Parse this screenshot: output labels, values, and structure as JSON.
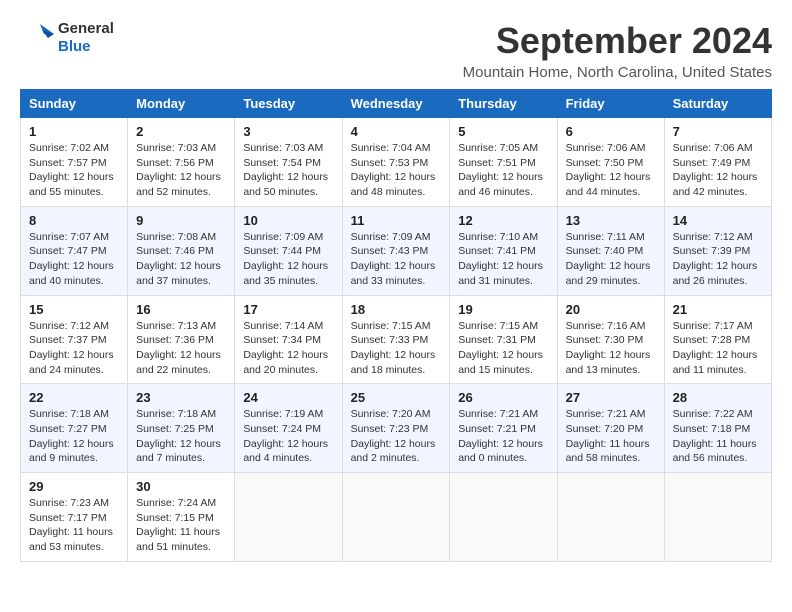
{
  "logo": {
    "text_general": "General",
    "text_blue": "Blue"
  },
  "title": "September 2024",
  "location": "Mountain Home, North Carolina, United States",
  "days_of_week": [
    "Sunday",
    "Monday",
    "Tuesday",
    "Wednesday",
    "Thursday",
    "Friday",
    "Saturday"
  ],
  "weeks": [
    [
      {
        "day": "1",
        "info": "Sunrise: 7:02 AM\nSunset: 7:57 PM\nDaylight: 12 hours\nand 55 minutes."
      },
      {
        "day": "2",
        "info": "Sunrise: 7:03 AM\nSunset: 7:56 PM\nDaylight: 12 hours\nand 52 minutes."
      },
      {
        "day": "3",
        "info": "Sunrise: 7:03 AM\nSunset: 7:54 PM\nDaylight: 12 hours\nand 50 minutes."
      },
      {
        "day": "4",
        "info": "Sunrise: 7:04 AM\nSunset: 7:53 PM\nDaylight: 12 hours\nand 48 minutes."
      },
      {
        "day": "5",
        "info": "Sunrise: 7:05 AM\nSunset: 7:51 PM\nDaylight: 12 hours\nand 46 minutes."
      },
      {
        "day": "6",
        "info": "Sunrise: 7:06 AM\nSunset: 7:50 PM\nDaylight: 12 hours\nand 44 minutes."
      },
      {
        "day": "7",
        "info": "Sunrise: 7:06 AM\nSunset: 7:49 PM\nDaylight: 12 hours\nand 42 minutes."
      }
    ],
    [
      {
        "day": "8",
        "info": "Sunrise: 7:07 AM\nSunset: 7:47 PM\nDaylight: 12 hours\nand 40 minutes."
      },
      {
        "day": "9",
        "info": "Sunrise: 7:08 AM\nSunset: 7:46 PM\nDaylight: 12 hours\nand 37 minutes."
      },
      {
        "day": "10",
        "info": "Sunrise: 7:09 AM\nSunset: 7:44 PM\nDaylight: 12 hours\nand 35 minutes."
      },
      {
        "day": "11",
        "info": "Sunrise: 7:09 AM\nSunset: 7:43 PM\nDaylight: 12 hours\nand 33 minutes."
      },
      {
        "day": "12",
        "info": "Sunrise: 7:10 AM\nSunset: 7:41 PM\nDaylight: 12 hours\nand 31 minutes."
      },
      {
        "day": "13",
        "info": "Sunrise: 7:11 AM\nSunset: 7:40 PM\nDaylight: 12 hours\nand 29 minutes."
      },
      {
        "day": "14",
        "info": "Sunrise: 7:12 AM\nSunset: 7:39 PM\nDaylight: 12 hours\nand 26 minutes."
      }
    ],
    [
      {
        "day": "15",
        "info": "Sunrise: 7:12 AM\nSunset: 7:37 PM\nDaylight: 12 hours\nand 24 minutes."
      },
      {
        "day": "16",
        "info": "Sunrise: 7:13 AM\nSunset: 7:36 PM\nDaylight: 12 hours\nand 22 minutes."
      },
      {
        "day": "17",
        "info": "Sunrise: 7:14 AM\nSunset: 7:34 PM\nDaylight: 12 hours\nand 20 minutes."
      },
      {
        "day": "18",
        "info": "Sunrise: 7:15 AM\nSunset: 7:33 PM\nDaylight: 12 hours\nand 18 minutes."
      },
      {
        "day": "19",
        "info": "Sunrise: 7:15 AM\nSunset: 7:31 PM\nDaylight: 12 hours\nand 15 minutes."
      },
      {
        "day": "20",
        "info": "Sunrise: 7:16 AM\nSunset: 7:30 PM\nDaylight: 12 hours\nand 13 minutes."
      },
      {
        "day": "21",
        "info": "Sunrise: 7:17 AM\nSunset: 7:28 PM\nDaylight: 12 hours\nand 11 minutes."
      }
    ],
    [
      {
        "day": "22",
        "info": "Sunrise: 7:18 AM\nSunset: 7:27 PM\nDaylight: 12 hours\nand 9 minutes."
      },
      {
        "day": "23",
        "info": "Sunrise: 7:18 AM\nSunset: 7:25 PM\nDaylight: 12 hours\nand 7 minutes."
      },
      {
        "day": "24",
        "info": "Sunrise: 7:19 AM\nSunset: 7:24 PM\nDaylight: 12 hours\nand 4 minutes."
      },
      {
        "day": "25",
        "info": "Sunrise: 7:20 AM\nSunset: 7:23 PM\nDaylight: 12 hours\nand 2 minutes."
      },
      {
        "day": "26",
        "info": "Sunrise: 7:21 AM\nSunset: 7:21 PM\nDaylight: 12 hours\nand 0 minutes."
      },
      {
        "day": "27",
        "info": "Sunrise: 7:21 AM\nSunset: 7:20 PM\nDaylight: 11 hours\nand 58 minutes."
      },
      {
        "day": "28",
        "info": "Sunrise: 7:22 AM\nSunset: 7:18 PM\nDaylight: 11 hours\nand 56 minutes."
      }
    ],
    [
      {
        "day": "29",
        "info": "Sunrise: 7:23 AM\nSunset: 7:17 PM\nDaylight: 11 hours\nand 53 minutes."
      },
      {
        "day": "30",
        "info": "Sunrise: 7:24 AM\nSunset: 7:15 PM\nDaylight: 11 hours\nand 51 minutes."
      },
      null,
      null,
      null,
      null,
      null
    ]
  ]
}
